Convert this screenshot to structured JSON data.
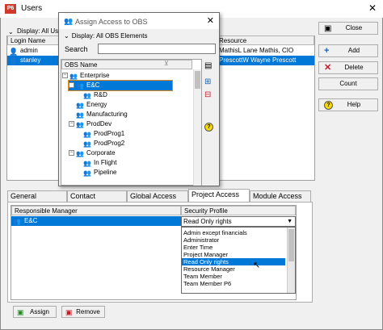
{
  "window": {
    "title": "Users",
    "logo": "P6"
  },
  "users_panel": {
    "display_label": "Display: All Us",
    "columns": [
      "Login Name",
      "Resource"
    ],
    "rows": [
      {
        "login": "admin",
        "resource": "MathisL Lane Mathis, CIO",
        "selected": false
      },
      {
        "login": "stanley",
        "resource": "PrescottW Wayne Prescott",
        "selected": true
      }
    ]
  },
  "side_buttons": {
    "close": "Close",
    "add": "Add",
    "delete": "Delete",
    "count": "Count",
    "help": "Help"
  },
  "dialog": {
    "title": "Assign Access to OBS",
    "display_label": "Display: All OBS Elements",
    "search_label": "Search",
    "search_value": "",
    "column": "OBS Name",
    "tree": [
      {
        "label": "Enterprise",
        "level": 0,
        "expander": "-",
        "selected": false
      },
      {
        "label": "E&C",
        "level": 1,
        "expander": "-",
        "selected": true
      },
      {
        "label": "R&D",
        "level": 2,
        "expander": "",
        "selected": false
      },
      {
        "label": "Energy",
        "level": 1,
        "expander": "",
        "selected": false
      },
      {
        "label": "Manufacturing",
        "level": 1,
        "expander": "",
        "selected": false
      },
      {
        "label": "ProdDev",
        "level": 1,
        "expander": "-",
        "selected": false
      },
      {
        "label": "ProdProg1",
        "level": 2,
        "expander": "",
        "selected": false
      },
      {
        "label": "ProdProg2",
        "level": 2,
        "expander": "",
        "selected": false
      },
      {
        "label": "Corporate",
        "level": 1,
        "expander": "-",
        "selected": false
      },
      {
        "label": "In Flight",
        "level": 2,
        "expander": "",
        "selected": false
      },
      {
        "label": "Pipeline",
        "level": 2,
        "expander": "",
        "selected": false
      }
    ]
  },
  "tabs": [
    "General",
    "Contact",
    "Global Access",
    "Project Access",
    "Module Access"
  ],
  "active_tab": "Project Access",
  "project_access": {
    "columns": [
      "Responsible Manager",
      "Security Profile"
    ],
    "row": {
      "manager": "E&C",
      "profile": "Read Only rights"
    },
    "profile_options": [
      "Admin except financials",
      "Administrator",
      "Enter Time",
      "Project Manager",
      "Read Only rights",
      "Resource Manager",
      "Team Member",
      "Team Member P6"
    ],
    "highlighted_option": "Read Only rights"
  },
  "bottom_buttons": {
    "assign": "Assign",
    "remove": "Remove"
  },
  "colors": {
    "selection": "#0078d7",
    "tree_selection_border": "#e08a1e"
  }
}
